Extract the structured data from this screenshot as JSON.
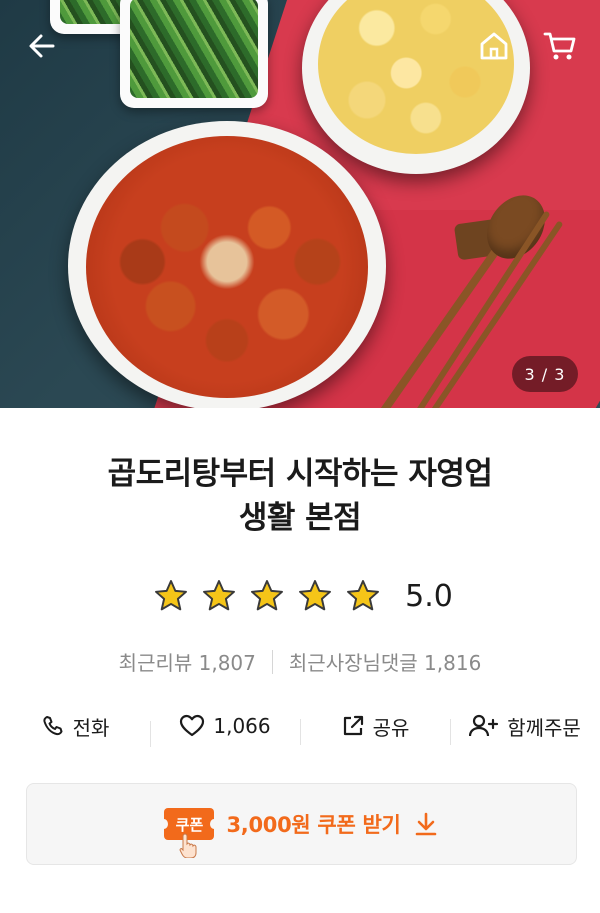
{
  "header": {
    "back_icon": "arrow-left-icon",
    "home_icon": "home-icon",
    "cart_icon": "cart-icon",
    "image_counter": "3 / 3"
  },
  "store": {
    "title_line1": "곱도리탕부터 시작하는 자영업",
    "title_line2": "생활 본점",
    "rating_value": 5.0,
    "rating_text": "5.0",
    "rating_max": 5
  },
  "stats": {
    "recent_reviews": "최근리뷰 1,807",
    "owner_replies": "최근사장님댓글 1,816"
  },
  "actions": [
    {
      "icon": "phone-icon",
      "label": "전화"
    },
    {
      "icon": "heart-icon",
      "label": "1,066"
    },
    {
      "icon": "share-icon",
      "label": "공유"
    },
    {
      "icon": "add-person-icon",
      "label": "함께주문"
    }
  ],
  "coupon": {
    "badge": "쿠폰",
    "label": "3,000원 쿠폰 받기",
    "download_icon": "download-icon"
  },
  "colors": {
    "accent": "#f26a1b",
    "star": "#f5c518",
    "text": "#1b1b1b",
    "muted": "#8a8a8a"
  }
}
